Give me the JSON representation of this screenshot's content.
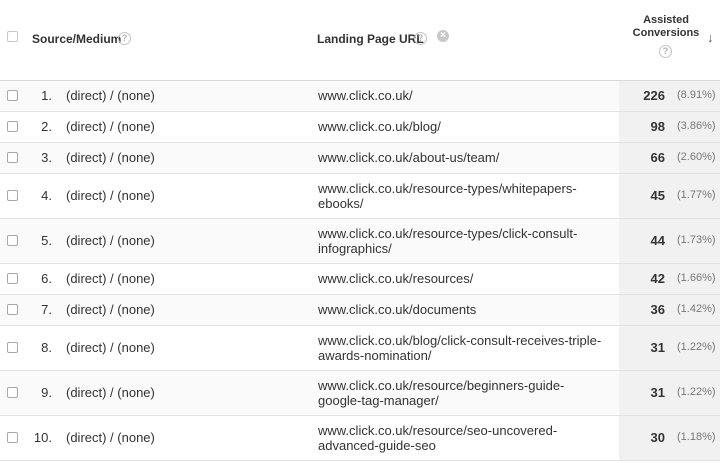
{
  "header": {
    "source_medium": "Source/Medium",
    "landing_page": "Landing Page URL",
    "metric_line1": "Assisted",
    "metric_line2": "Conversions",
    "help_glyph": "?",
    "remove_glyph": "×",
    "sort_glyph": "↓"
  },
  "rows": [
    {
      "index": "1.",
      "source": "(direct) / (none)",
      "url": [
        "www.click.co.uk/"
      ],
      "value": "226",
      "percent": "(8.91%)"
    },
    {
      "index": "2.",
      "source": "(direct) / (none)",
      "url": [
        "www.click.co.uk/blog/"
      ],
      "value": "98",
      "percent": "(3.86%)"
    },
    {
      "index": "3.",
      "source": "(direct) / (none)",
      "url": [
        "www.click.co.uk/about-us/team/"
      ],
      "value": "66",
      "percent": "(2.60%)"
    },
    {
      "index": "4.",
      "source": "(direct) / (none)",
      "url": [
        "www.click.co.uk/resource-types/whitepapers-",
        "ebooks/"
      ],
      "value": "45",
      "percent": "(1.77%)"
    },
    {
      "index": "5.",
      "source": "(direct) / (none)",
      "url": [
        "www.click.co.uk/resource-types/click-consult-",
        "infographics/"
      ],
      "value": "44",
      "percent": "(1.73%)"
    },
    {
      "index": "6.",
      "source": "(direct) / (none)",
      "url": [
        "www.click.co.uk/resources/"
      ],
      "value": "42",
      "percent": "(1.66%)"
    },
    {
      "index": "7.",
      "source": "(direct) / (none)",
      "url": [
        "www.click.co.uk/documents"
      ],
      "value": "36",
      "percent": "(1.42%)"
    },
    {
      "index": "8.",
      "source": "(direct) / (none)",
      "url": [
        "www.click.co.uk/blog/click-consult-receives-triple-",
        "awards-nomination/"
      ],
      "value": "31",
      "percent": "(1.22%)"
    },
    {
      "index": "9.",
      "source": "(direct) / (none)",
      "url": [
        "www.click.co.uk/resource/beginners-guide-",
        "google-tag-manager/"
      ],
      "value": "31",
      "percent": "(1.22%)"
    },
    {
      "index": "10.",
      "source": "(direct) / (none)",
      "url": [
        "www.click.co.uk/resource/seo-uncovered-",
        "advanced-guide-seo"
      ],
      "value": "30",
      "percent": "(1.18%)"
    }
  ]
}
